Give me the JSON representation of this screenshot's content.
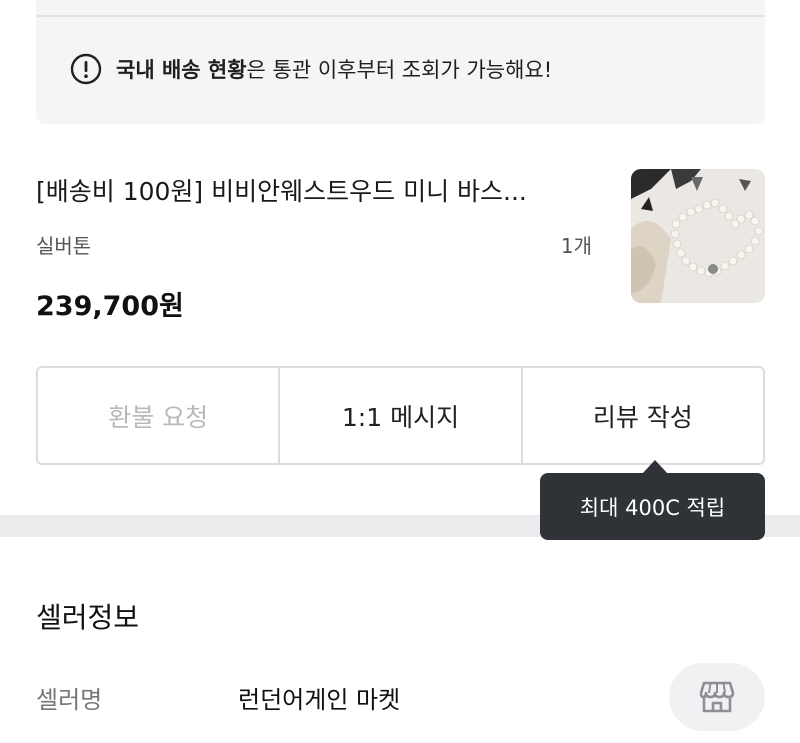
{
  "notice": {
    "bold_text": "국내 배송 현황",
    "text": "은 통관 이후부터 조회가 가능해요!",
    "icon": "alert-circle-icon"
  },
  "product": {
    "title": "[배송비 100원] 비비안웨스트우드 미니 바스...",
    "option": "실버톤",
    "quantity": "1개",
    "price": "239,700원",
    "image": "pearl-necklace-photo"
  },
  "actions": {
    "refund_label": "환불 요청",
    "message_label": "1:1 메시지",
    "review_label": "리뷰 작성"
  },
  "tooltip": {
    "text": "최대 400C 적립"
  },
  "seller": {
    "section_title": "셀러정보",
    "name_label": "셀러명",
    "name": "런던어게인 마켓",
    "store_icon": "store-icon"
  }
}
